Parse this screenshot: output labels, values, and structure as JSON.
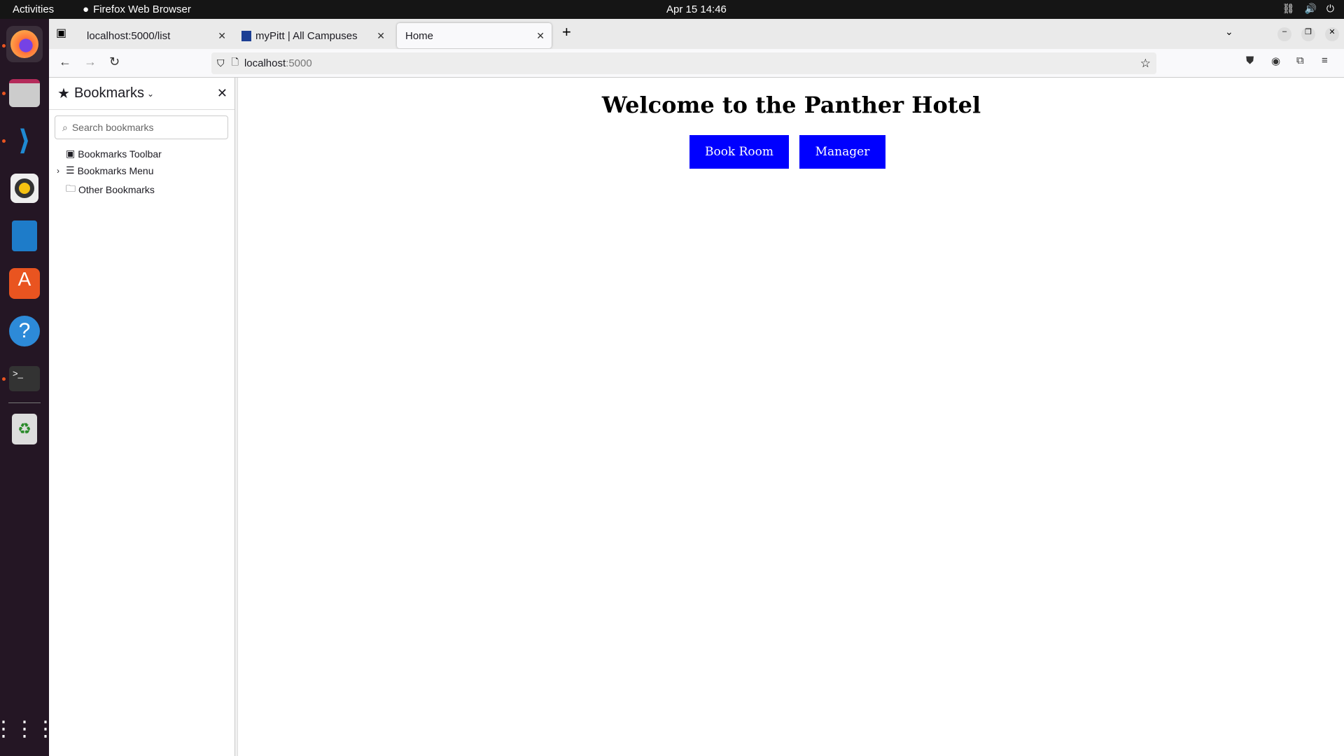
{
  "system": {
    "activities": "Activities",
    "app_name": "Firefox Web Browser",
    "clock": "Apr 15  14:46"
  },
  "dock": [
    "firefox-icon",
    "files-icon",
    "vscode-icon",
    "rhythmbox-icon",
    "writer-icon",
    "app-center-icon",
    "help-icon",
    "terminal-icon",
    "trash-icon",
    "app-grid-icon"
  ],
  "tabs": [
    {
      "label": "localhost:5000/list"
    },
    {
      "label": "myPitt | All Campuses"
    },
    {
      "label": "Home"
    }
  ],
  "url": {
    "host": "localhost",
    "port": ":5000"
  },
  "sidebar": {
    "title": "Bookmarks",
    "search_placeholder": "Search bookmarks",
    "items": [
      {
        "label": "Bookmarks Toolbar"
      },
      {
        "label": "Bookmarks Menu"
      },
      {
        "label": "Other Bookmarks"
      }
    ]
  },
  "page": {
    "heading": "Welcome to the Panther Hotel",
    "book_label": "Book Room",
    "manager_label": "Manager",
    "button_color": "#0000ff"
  }
}
